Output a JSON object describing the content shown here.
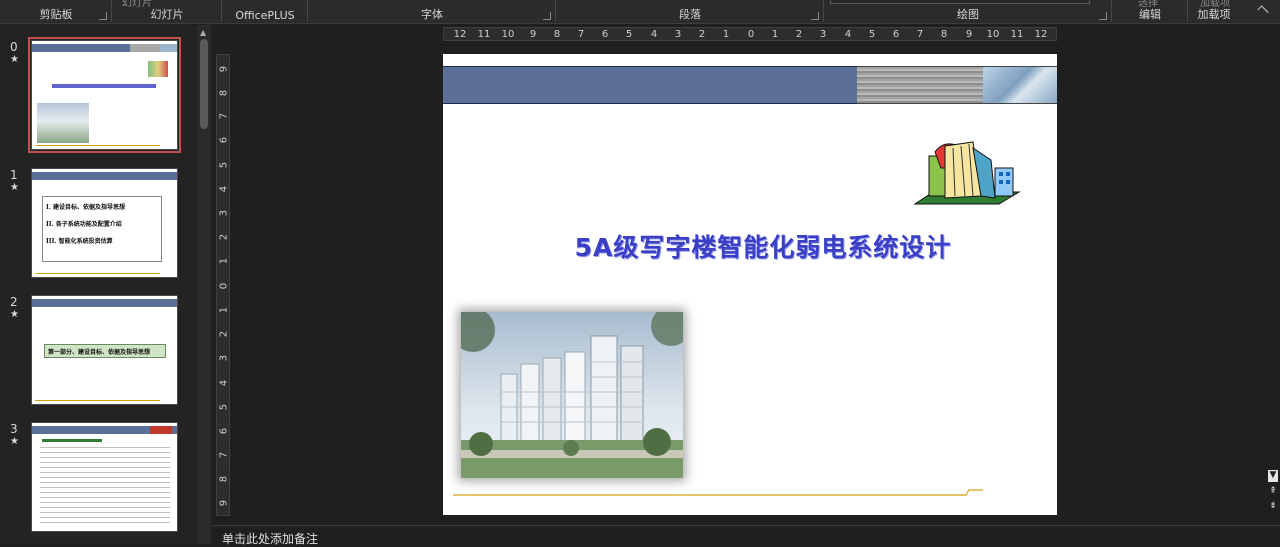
{
  "ribbon": {
    "groups": [
      {
        "label": "剪贴板"
      },
      {
        "label": "幻灯片",
        "top_text": "幻灯片"
      },
      {
        "label": "OfficePLUS"
      },
      {
        "label": "字体"
      },
      {
        "label": "段落"
      },
      {
        "label": "绘图"
      },
      {
        "label": "编辑",
        "top_text": "选择"
      },
      {
        "label": "加载项",
        "top_text": "加载项"
      }
    ]
  },
  "thumbnails": [
    {
      "number": "0",
      "marker": "★",
      "selected": true
    },
    {
      "number": "1",
      "marker": "★",
      "items": [
        "I.    建设目标、依据及指导思想",
        "II.  各子系统功能及配置介绍",
        "III.  智能化系统投资估算"
      ]
    },
    {
      "number": "2",
      "marker": "★",
      "band_text": "第一部分、建设目标、依据及指导思想"
    },
    {
      "number": "3",
      "marker": "★"
    }
  ],
  "ruler": {
    "horizontal": [
      "12",
      "11",
      "10",
      "9",
      "8",
      "7",
      "6",
      "5",
      "4",
      "3",
      "2",
      "1",
      "0",
      "1",
      "2",
      "3",
      "4",
      "5",
      "6",
      "7",
      "8",
      "9",
      "10",
      "11",
      "12"
    ],
    "vertical": [
      "9",
      "8",
      "7",
      "6",
      "5",
      "4",
      "3",
      "2",
      "1",
      "0",
      "1",
      "2",
      "3",
      "4",
      "5",
      "6",
      "7",
      "8",
      "9"
    ]
  },
  "slide": {
    "title": "5A级写字楼智能化弱电系统设计"
  },
  "notes": {
    "placeholder": "单击此处添加备注"
  },
  "colors": {
    "accent_selected": "#c0504d",
    "title_blue": "#3a3fc6",
    "header_bar": "#5b6f97",
    "gold_line": "#d4a017"
  }
}
